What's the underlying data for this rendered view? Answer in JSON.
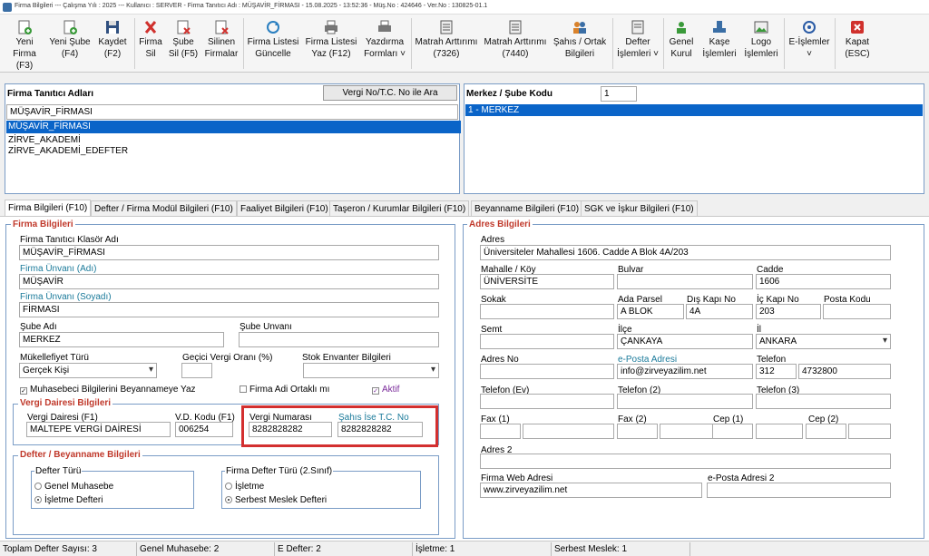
{
  "window": {
    "title": "Firma Bilgileri  ---  Çalışma Yılı : 2025   ---   Kullanıcı : SERVER - Firma Tanıtıcı Adı : MÜŞAVİR_FİRMASI - 15.08.2025 - 13:52:36 - Müş.No : 424646 - Ver.No : 130825-01.1"
  },
  "toolbar": {
    "yeni_firma": "Yeni Firma (F3)",
    "yeni_sube": "Yeni Şube (F4)",
    "kaydet": "Kaydet (F2)",
    "firma_sil": "Firma Sil",
    "sube_sil": "Şube Sil (F5)",
    "silinen": "Silinen Firmalar",
    "firma_listesi_guncelle": "Firma Listesi Güncelle",
    "firma_listesi_yaz": "Firma Listesi Yaz (F12)",
    "yazdirma": "Yazdırma Formları ˅",
    "matrah_7326": "Matrah Arttırımı (7326)",
    "matrah_7440": "Matrah Arttırımı (7440)",
    "sahis_ortak": "Şahıs / Ortak Bilgileri",
    "defter_islemleri": "Defter İşlemleri ˅",
    "genel_kurul": "Genel Kurul",
    "kase": "Kaşe İşlemleri",
    "logo": "Logo İşlemleri",
    "e_islemler": "E-İşlemler ˅",
    "kapat": "Kapat (ESC)"
  },
  "firma_list": {
    "header": "Firma Tanıtıcı Adları",
    "search_button": "Vergi No/T.C. No ile Ara",
    "filter_value": "MÜŞAVİR_FİRMASI",
    "items": [
      "MÜŞAVİR_FİRMASI",
      "ZİRVE_AKADEMİ",
      "ZİRVE_AKADEMİ_EDEFTER"
    ]
  },
  "sube": {
    "header": "Merkez / Şube Kodu",
    "code": "1",
    "items": [
      "1 - MERKEZ"
    ]
  },
  "tabs": [
    "Firma Bilgileri (F10)",
    "Defter / Firma Modül Bilgileri (F10)",
    "Faaliyet Bilgileri (F10)",
    "Taşeron / Kurumlar Bilgileri (F10)",
    "Beyanname Bilgileri (F10)",
    "SGK ve İşkur Bilgileri (F10)"
  ],
  "firma": {
    "group_title": "Firma Bilgileri",
    "klasor_label": "Firma Tanıtıcı Klasör Adı",
    "klasor_value": "MÜŞAVİR_FİRMASI",
    "unvan_adi_label": "Firma Ünvanı (Adı)",
    "unvan_adi_value": "MÜŞAVİR",
    "unvan_soyadi_label": "Firma Ünvanı (Soyadı)",
    "unvan_soyadi_value": "FİRMASI",
    "sube_adi_label": "Şube Adı",
    "sube_adi_value": "MERKEZ",
    "sube_unvani_label": "Şube Unvanı",
    "sube_unvani_value": "",
    "mukellef_label": "Mükellefiyet Türü",
    "mukellef_value": "Gerçek Kişi",
    "gecici_label": "Geçici Vergi Oranı (%)",
    "gecici_value": "",
    "stok_label": "Stok Envanter Bilgileri",
    "stok_value": "",
    "muhasebeci_label": "Muhasebeci Bilgilerini Beyannameye Yaz",
    "ortakli_label": "Firma Adi Ortaklı mı",
    "aktif_label": "Aktif"
  },
  "vergi": {
    "group_title": "Vergi Dairesi Bilgileri",
    "daire_label": "Vergi Dairesi (F1)",
    "daire_value": "MALTEPE VERGİ DAİRESİ",
    "vd_kodu_label": "V.D. Kodu (F1)",
    "vd_kodu_value": "006254",
    "no_label": "Vergi Numarası",
    "no_value": "8282828282",
    "tc_label": "Şahıs İse T.C. No",
    "tc_value": "8282828282"
  },
  "defter": {
    "group_title": "Defter / Beyanname Bilgileri",
    "turu_title": "Defter Türü",
    "genel": "Genel Muhasebe",
    "isletme": "İşletme Defteri",
    "firma_turu_title": "Firma Defter Türü (2.Sınıf)",
    "f_isletme": "İşletme",
    "serbest": "Serbest Meslek Defteri"
  },
  "adres": {
    "group_title": "Adres Bilgileri",
    "adres_label": "Adres",
    "adres_value": "Üniversiteler Mahallesi 1606. Cadde A Blok 4A/203",
    "mahalle_label": "Mahalle / Köy",
    "mahalle_value": "ÜNİVERSİTE",
    "bulvar_label": "Bulvar",
    "bulvar_value": "",
    "cadde_label": "Cadde",
    "cadde_value": "1606",
    "sokak_label": "Sokak",
    "sokak_value": "",
    "ada_label": "Ada Parsel",
    "ada_value": "A BLOK",
    "dis_label": "Dış Kapı No",
    "dis_value": "4A",
    "ic_label": "İç Kapı No",
    "ic_value": "203",
    "posta_label": "Posta Kodu",
    "posta_value": "",
    "semt_label": "Semt",
    "semt_value": "",
    "ilce_label": "İlçe",
    "ilce_value": "ÇANKAYA",
    "il_label": "İl",
    "il_value": "ANKARA",
    "adresno_label": "Adres No",
    "adresno_value": "",
    "eposta_label": "e-Posta Adresi",
    "eposta_value": "info@zirveyazilim.net",
    "telefon_label": "Telefon",
    "tel_kod": "312",
    "tel_no": "4732800",
    "tel_ev_label": "Telefon (Ev)",
    "tel2_label": "Telefon (2)",
    "tel3_label": "Telefon (3)",
    "fax1_label": "Fax (1)",
    "fax2_label": "Fax (2)",
    "cep1_label": "Cep (1)",
    "cep2_label": "Cep (2)",
    "adres2_label": "Adres 2",
    "adres2_value": "",
    "web_label": "Firma Web Adresi",
    "web_value": "www.zirveyazilim.net",
    "eposta2_label": "e-Posta Adresi 2",
    "eposta2_value": ""
  },
  "status": {
    "toplam": "Toplam Defter Sayısı: 3",
    "genel": "Genel Muhasebe: 2",
    "edefter": "E Defter: 2",
    "isletme": "İşletme: 1",
    "serbest": "Serbest Meslek: 1"
  }
}
